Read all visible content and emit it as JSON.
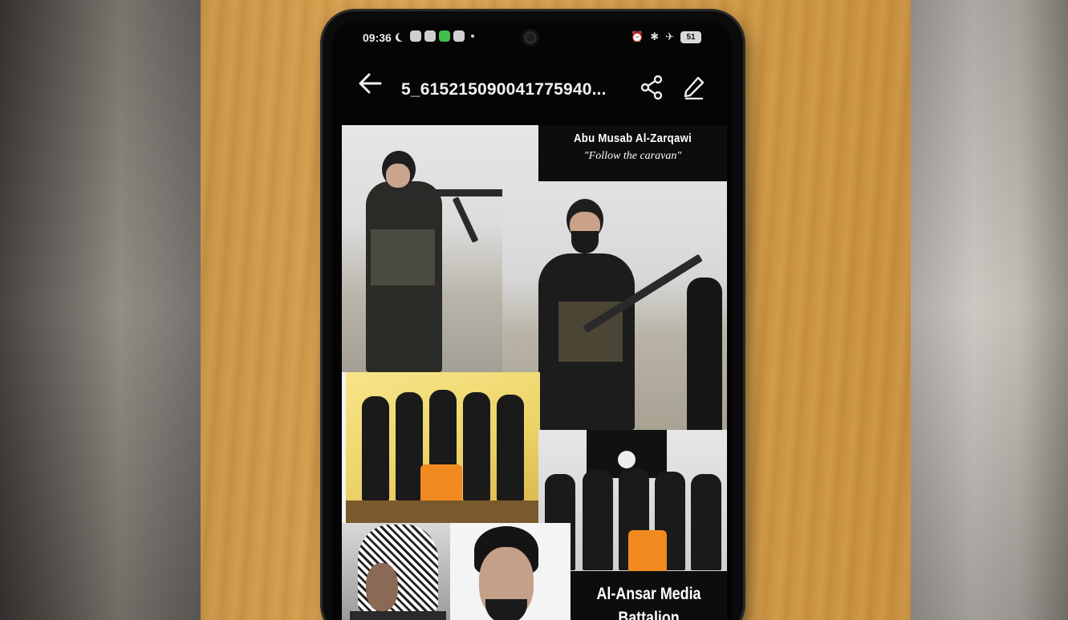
{
  "status_bar": {
    "time": "09:36",
    "battery": "51"
  },
  "app_bar": {
    "file_title": "5_615215090041775940..."
  },
  "collage": {
    "title": "Abu Musab Al-Zarqawi",
    "subtitle": "\"Follow the caravan\"",
    "media_line1": "Al-Ansar Media",
    "media_line2": "Battalion"
  },
  "icons": {
    "back": "back-arrow-icon",
    "share": "share-icon",
    "edit": "edit-pencil-icon"
  }
}
